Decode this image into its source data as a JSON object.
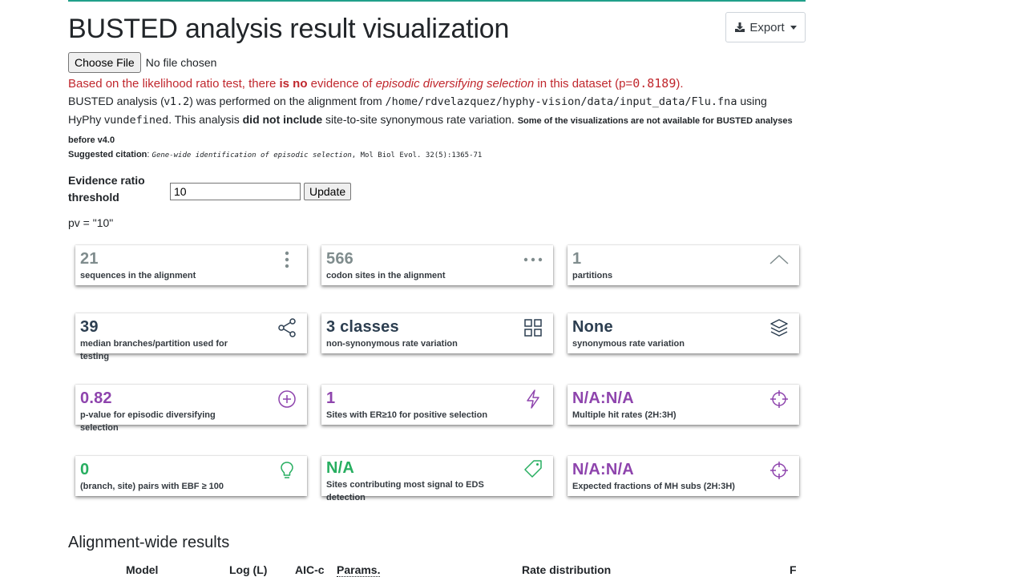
{
  "page": {
    "title": "BUSTED analysis result visualization",
    "export_label": "Export"
  },
  "file": {
    "button_label": "Choose File",
    "status": "No file chosen"
  },
  "summary": {
    "pre": "Based on the likelihood ratio test, there ",
    "bold": "is no",
    "mid": " evidence of ",
    "italic": "episodic diversifying selection",
    "post": " in this dataset (p=",
    "pvalue": "0.8189",
    "end": ")."
  },
  "analysis": {
    "part1": "BUSTED analysis (v",
    "version": "1.2",
    "part2": ") was performed on the alignment from ",
    "path": "/home/rdvelazquez/hyphy-vision/data/input_data/Flu.fna",
    "part3": " using HyPhy v",
    "hyphy_version": "undefined",
    "part4": ". This analysis ",
    "bold": "did not include",
    "part5": " site-to-site synonymous rate variation. ",
    "small": "Some of the visualizations are not available for BUSTED analyses before v4.0"
  },
  "citation": {
    "label": "Suggested citation",
    "colon": ": ",
    "title": "Gene-wide identification of episodic selection",
    "journal": ", Mol Biol Evol. 32(5):1365-71"
  },
  "threshold": {
    "label": "Evidence ratio threshold",
    "value": "10",
    "update_label": "Update"
  },
  "pv_text": "pv = \"10\"",
  "cards": [
    {
      "value": "21",
      "label": "sequences in the alignment",
      "icon": "vertical-dots-icon",
      "color": "#7f8c8d"
    },
    {
      "value": "566",
      "label": "codon sites in the alignment",
      "icon": "horizontal-dots-icon",
      "color": "#7f8c8d"
    },
    {
      "value": "1",
      "label": "partitions",
      "icon": "chevron-up-icon",
      "color": "#7f8c8d"
    },
    {
      "value": "39",
      "label": "median branches/partition used for testing",
      "icon": "share-icon",
      "color": "#2c3e50"
    },
    {
      "value": "3 classes",
      "label": "non-synonymous rate variation",
      "icon": "grid-icon",
      "color": "#2c3e50"
    },
    {
      "value": "None",
      "label": "synonymous rate variation",
      "icon": "layers-icon",
      "color": "#2c3e50"
    },
    {
      "value": "0.82",
      "label": "p-value for episodic diversifying selection",
      "icon": "plus-circle-icon",
      "color": "#8e44ad"
    },
    {
      "value": "1",
      "label": "Sites with ER≥10 for positive selection",
      "icon": "lightning-icon",
      "color": "#8e44ad"
    },
    {
      "value": "N/A:N/A",
      "label": "Multiple hit rates (2H:3H)",
      "icon": "crosshair-icon",
      "color": "#8e44ad"
    },
    {
      "value": "0",
      "label": "(branch, site) pairs with EBF ≥ 100",
      "icon": "lightbulb-icon",
      "color": "#27ae60"
    },
    {
      "value": "N/A",
      "label": "Sites contributing most signal to EDS detection",
      "icon": "tag-icon",
      "color": "#27ae60"
    },
    {
      "value": "N/A:N/A",
      "label": "Expected fractions of MH subs (2H:3H)",
      "icon": "crosshair-icon",
      "color": "#8e44ad"
    }
  ],
  "alignment": {
    "title": "Alignment-wide results",
    "columns": [
      "Model",
      "Log (L)",
      "AIC-c",
      "Params.",
      "Rate distribution",
      "F"
    ]
  }
}
